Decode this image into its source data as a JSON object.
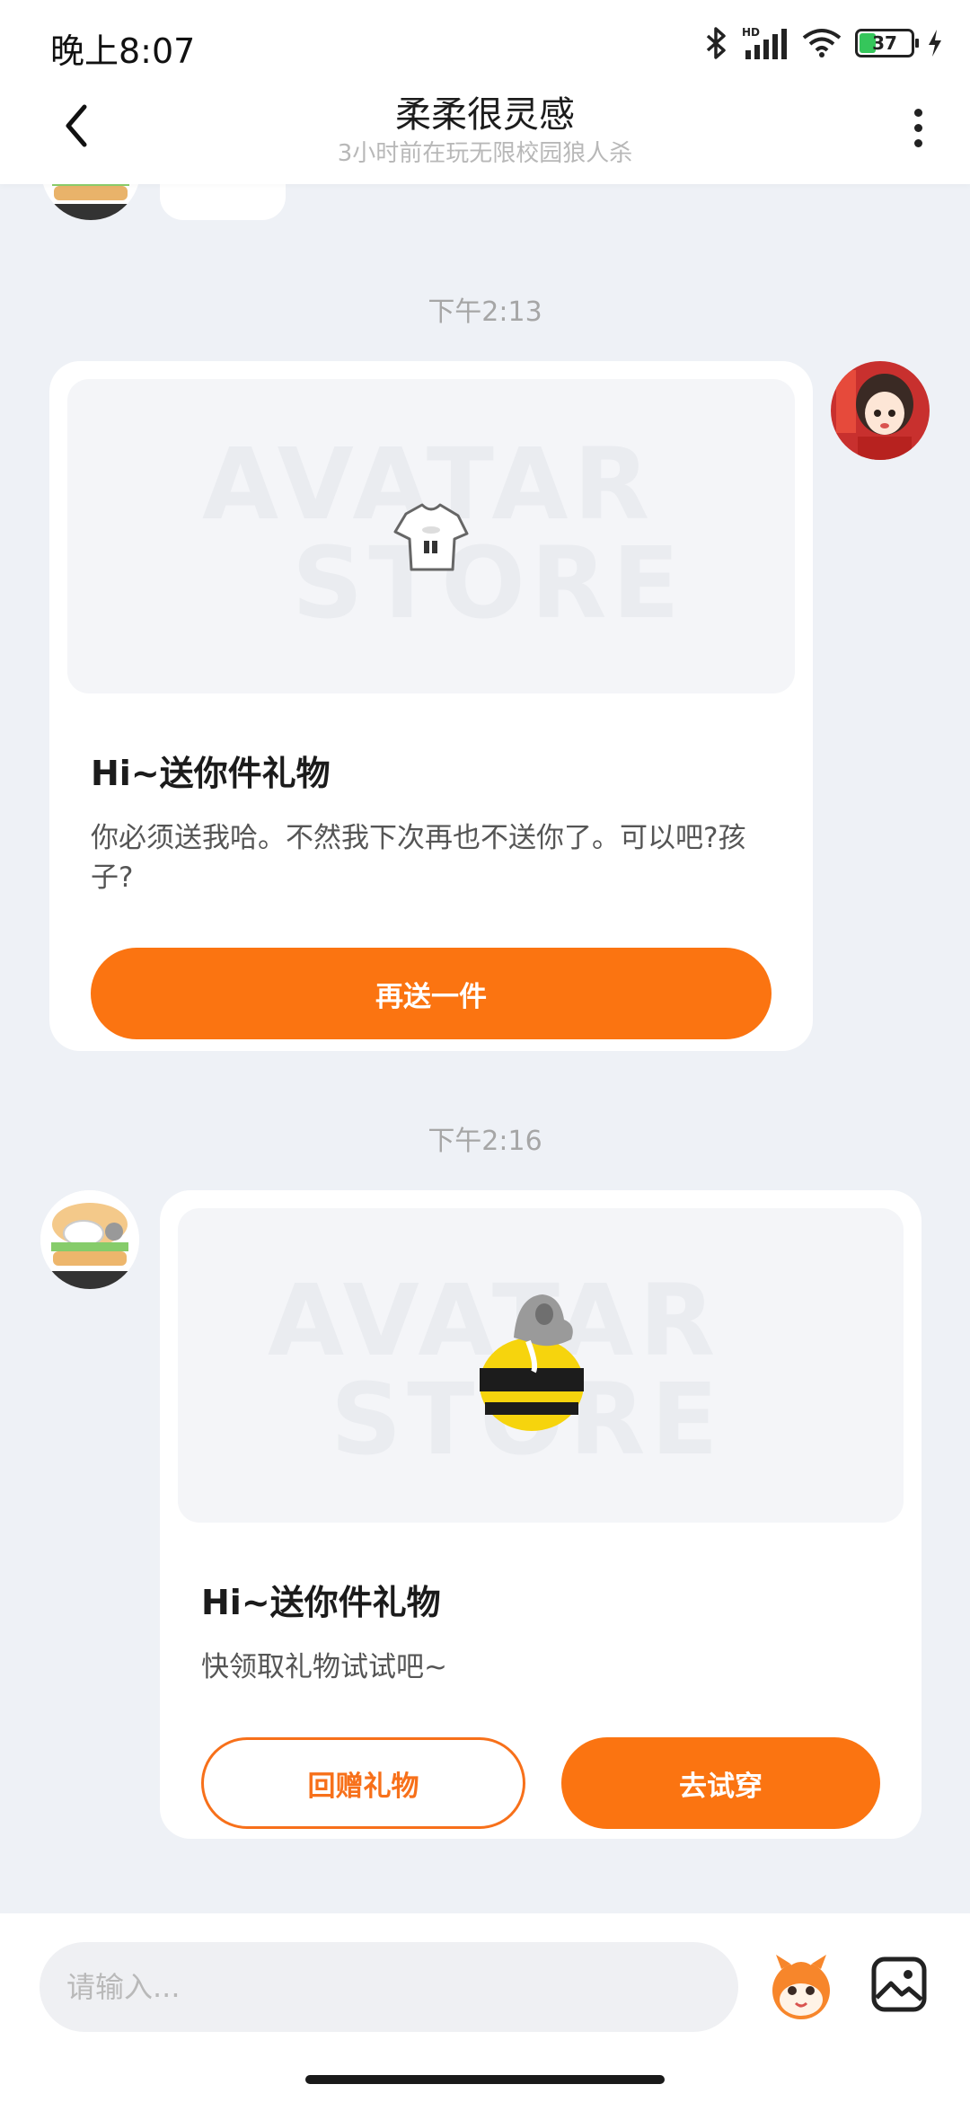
{
  "status_bar": {
    "time": "晚上8:07",
    "hd_label": "HD",
    "battery_level": "37"
  },
  "header": {
    "title": "柔柔很灵感",
    "subtitle": "3小时前在玩无限校园狼人杀"
  },
  "messages": [
    {
      "time": "下午2:13",
      "card": {
        "watermark_line1": "AVATAR",
        "watermark_line2": "STORE",
        "title": "Hi~送你件礼物",
        "desc": "你必须送我哈。不然我下次再也不送你了。可以吧?孩子?",
        "button": "再送一件"
      }
    },
    {
      "time": "下午2:16",
      "card": {
        "watermark_line1": "AVATAR",
        "watermark_line2": "STORE",
        "title": "Hi~送你件礼物",
        "desc": "快领取礼物试试吧~",
        "button_left": "回赠礼物",
        "button_right": "去试穿"
      }
    }
  ],
  "input": {
    "placeholder": "请输入..."
  },
  "colors": {
    "accent": "#fb7411",
    "background": "#eef1f6",
    "card": "#ffffff"
  },
  "icons": [
    "back-arrow-icon",
    "more-vertical-icon",
    "bluetooth-icon",
    "signal-icon",
    "wifi-icon",
    "battery-icon",
    "charging-icon",
    "mascot-emoji-icon",
    "image-icon"
  ]
}
